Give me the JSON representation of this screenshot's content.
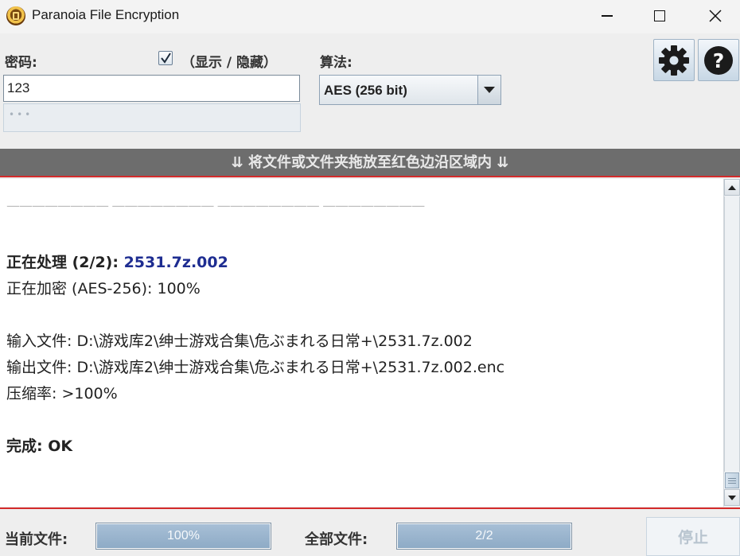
{
  "window": {
    "title": "Paranoia File Encryption",
    "icon": "padlock-app-icon"
  },
  "controls": {
    "password_label": "密码:",
    "show_hide_label": "（显示 / 隐藏）",
    "show_hide_checked": true,
    "password_value": "123",
    "password_mask": "•••",
    "algorithm_label": "算法:",
    "algorithm_value": "AES (256 bit)",
    "settings_icon": "gear-icon",
    "help_icon": "help-icon"
  },
  "drop_banner": "⇊ 将文件或文件夹拖放至红色边沿区域内 ⇊",
  "log": {
    "separator": "———————— ———————— ———————— ————————",
    "processing_label": "正在处理 (2/2): ",
    "processing_file": "2531.7z.002",
    "encrypting": "正在加密 (AES-256): 100%",
    "input_file": "输入文件: D:\\游戏库2\\绅士游戏合集\\危ぶまれる日常+\\2531.7z.002",
    "output_file": "输出文件: D:\\游戏库2\\绅士游戏合集\\危ぶまれる日常+\\2531.7z.002.enc",
    "compression": "压缩率: >100%",
    "done": "完成: OK"
  },
  "footer": {
    "current_file_label": "当前文件:",
    "current_progress_text": "100%",
    "current_progress_fraction": 1.0,
    "all_files_label": "全部文件:",
    "all_progress_text": "2/2",
    "all_progress_fraction": 1.0,
    "stop_label": "停止"
  },
  "colors": {
    "accent_red": "#d42b2b",
    "banner_gray": "#6d6d6d",
    "filename_blue": "#1e2d91"
  }
}
